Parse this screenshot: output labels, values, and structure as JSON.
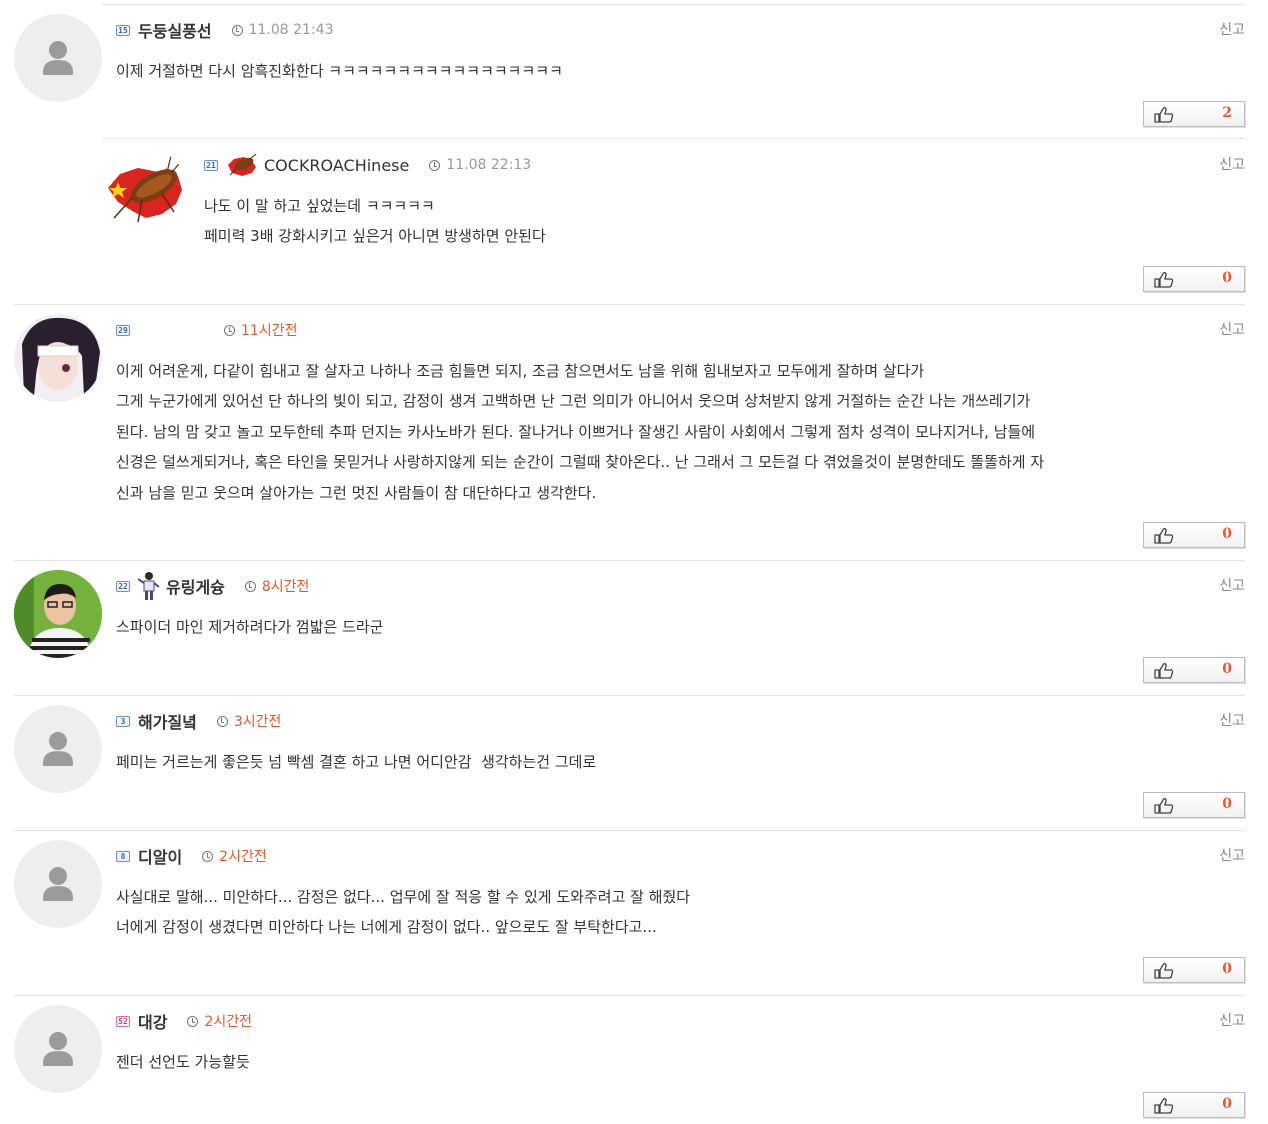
{
  "report_label": "신고",
  "comments": [
    {
      "level": "15",
      "nickname": "두둥실풍선",
      "time": "11.08 21:43",
      "lines": [
        "이제 거절하면 다시 암흑진화한다 ㅋㅋㅋㅋㅋㅋㅋㅋㅋㅋㅋㅋㅋㅋㅋㅋㅋ"
      ],
      "likes": "2"
    },
    {
      "level": "21",
      "nickname": "COCKROACHinese",
      "time": "11.08 22:13",
      "lines": [
        "나도 이 말 하고 싶었는데 ㅋㅋㅋㅋㅋ",
        "페미력 3배 강화시키고 싶은거 아니면 방생하면 안된다"
      ],
      "likes": "0"
    },
    {
      "level": "29",
      "nickname": "",
      "time": "11시간전",
      "lines": [
        "이게 어려운게, 다같이 힘내고 잘 살자고 나하나 조금 힘들면 되지, 조금 참으면서도 남을 위해 힘내보자고 모두에게 잘하며 살다가",
        "그게 누군가에게 있어선 단 하나의 빛이 되고, 감정이 생겨 고백하면 난 그런 의미가 아니어서 웃으며 상처받지 않게 거절하는 순간 나는 개쓰레기가",
        "된다. 남의 맘 갖고 놀고 모두한테 추파 던지는 카사노바가 된다. 잘나거나 이쁘거나 잘생긴 사람이 사회에서 그렇게 점차 성격이 모나지거나, 남들에",
        "신경은 덜쓰게되거나, 혹은 타인을 못믿거나 사랑하지않게 되는 순간이 그럴때 찾아온다.. 난 그래서 그 모든걸 다 겪었을것이 분명한데도 똘똘하게 자",
        "신과 남을 믿고 웃으며 살아가는 그런 멋진 사람들이 참 대단하다고 생각한다."
      ],
      "likes": "0"
    },
    {
      "level": "22",
      "nickname": "유링게슝",
      "time": "8시간전",
      "lines": [
        "스파이더 마인 제거하려다가 껌밟은 드라군"
      ],
      "likes": "0"
    },
    {
      "level": "3",
      "nickname": "해가질녘",
      "time": "3시간전",
      "lines": [
        "페미는 거르는게 좋은듯 넘 빡셈 결혼 하고 나면 어디안감  생각하는건 그데로"
      ],
      "likes": "0"
    },
    {
      "level": "8",
      "nickname": "디알이",
      "time": "2시간전",
      "lines": [
        "사실대로 말해... 미안하다... 감정은 없다... 업무에 잘 적응 할 수 있게 도와주려고 잘 해줬다",
        "너에게 감정이 생겼다면 미안하다 나는 너에게 감정이 없다.. 앞으로도 잘 부탁한다고..."
      ],
      "likes": "0"
    },
    {
      "level": "52",
      "nickname": "대강",
      "time": "2시간전",
      "lines": [
        "젠더 선언도 가능할듯"
      ],
      "likes": "0"
    }
  ]
}
